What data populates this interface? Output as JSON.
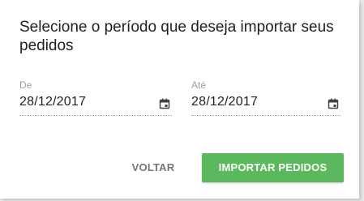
{
  "dialog": {
    "title": "Selecione o período que deseja importar seus pedidos",
    "from": {
      "label": "De",
      "value": "28/12/2017",
      "icon": "calendar-icon"
    },
    "to": {
      "label": "Até",
      "value": "28/12/2017",
      "icon": "calendar-icon"
    },
    "actions": {
      "back_label": "VOLTAR",
      "import_label": "IMPORTAR PEDIDOS"
    }
  },
  "colors": {
    "primary": "#5cb85c",
    "text": "#212121",
    "muted": "#9e9e9e",
    "secondary_button": "#757575"
  }
}
